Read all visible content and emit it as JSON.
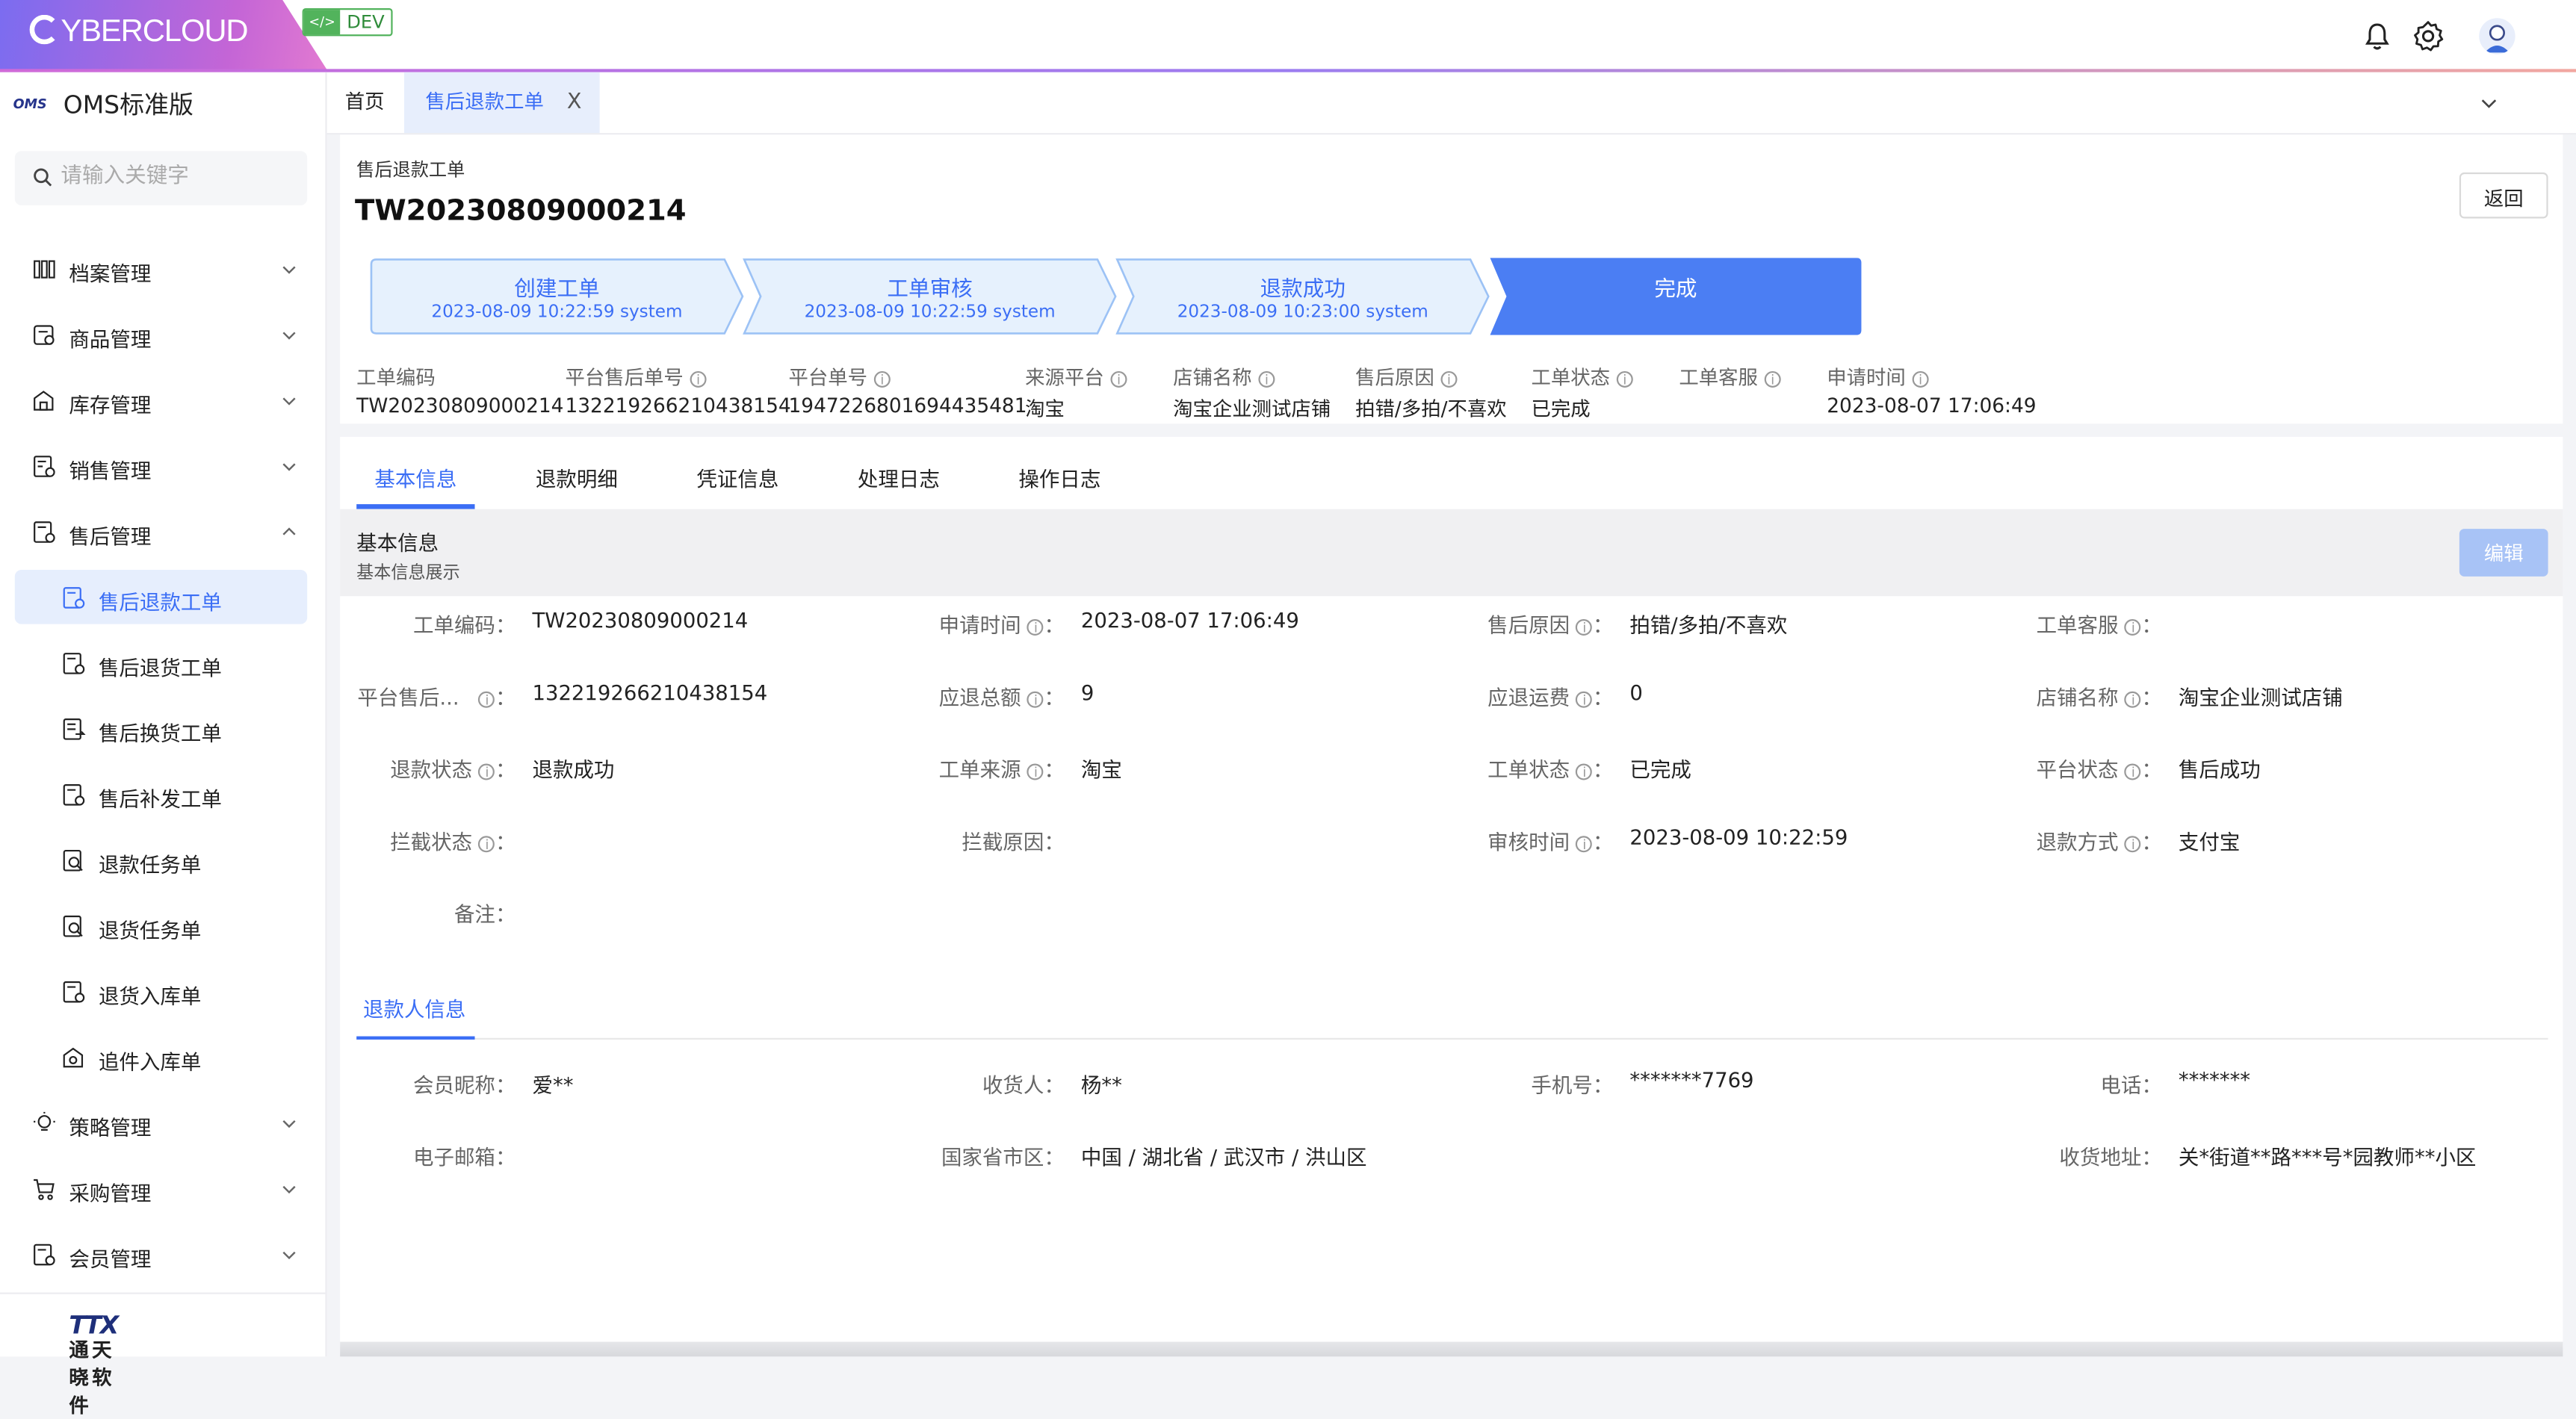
{
  "app": {
    "logo_text": "YBERCLOUD",
    "env_badge": "DEV",
    "env_badge_icon": "code-icon"
  },
  "sidebar": {
    "title": "OMS标准版",
    "brand_mark": "OMS",
    "search_placeholder": "请输入关键字",
    "menu": [
      {
        "label": "档案管理",
        "icon": "archive-icon",
        "expanded": false
      },
      {
        "label": "商品管理",
        "icon": "goods-icon",
        "expanded": false
      },
      {
        "label": "库存管理",
        "icon": "warehouse-icon",
        "expanded": false
      },
      {
        "label": "销售管理",
        "icon": "sales-icon",
        "expanded": false
      },
      {
        "label": "售后管理",
        "icon": "aftersale-icon",
        "expanded": true
      }
    ],
    "submenu": [
      {
        "label": "售后退款工单",
        "active": true
      },
      {
        "label": "售后退货工单"
      },
      {
        "label": "售后换货工单"
      },
      {
        "label": "售后补发工单"
      },
      {
        "label": "退款任务单"
      },
      {
        "label": "退货任务单"
      },
      {
        "label": "退货入库单"
      },
      {
        "label": "追件入库单"
      }
    ],
    "menu2": [
      {
        "label": "策略管理",
        "icon": "strategy-icon"
      },
      {
        "label": "采购管理",
        "icon": "cart-icon"
      },
      {
        "label": "会员管理",
        "icon": "member-icon"
      }
    ],
    "footer_logo": "TTX",
    "footer_company": "通天晓软件"
  },
  "tabbar": {
    "home": "首页",
    "current": "售后退款工单",
    "close": "X"
  },
  "page": {
    "breadcrumb": "售后退款工单",
    "order_no": "TW20230809000214",
    "back_label": "返回",
    "steps": [
      {
        "title": "创建工单",
        "detail": "2023-08-09 10:22:59 system",
        "state": "finished"
      },
      {
        "title": "工单审核",
        "detail": "2023-08-09 10:22:59 system",
        "state": "finished"
      },
      {
        "title": "退款成功",
        "detail": "2023-08-09 10:23:00 system",
        "state": "finished"
      },
      {
        "title": "完成",
        "detail": "",
        "state": "current"
      }
    ],
    "summary": [
      {
        "label": "工单编码",
        "value": "TW20230809000214",
        "help": false
      },
      {
        "label": "平台售后单号",
        "value": "132219266210438154",
        "help": true
      },
      {
        "label": "平台单号",
        "value": "1947226801694435481",
        "help": true
      },
      {
        "label": "来源平台",
        "value": "淘宝",
        "help": true
      },
      {
        "label": "店铺名称",
        "value": "淘宝企业测试店铺",
        "help": true
      },
      {
        "label": "售后原因",
        "value": "拍错/多拍/不喜欢",
        "help": true
      },
      {
        "label": "工单状态",
        "value": "已完成",
        "help": true
      },
      {
        "label": "工单客服",
        "value": "",
        "help": true
      },
      {
        "label": "申请时间",
        "value": "2023-08-07 17:06:49",
        "help": true
      }
    ]
  },
  "detail_tabs": [
    "基本信息",
    "退款明细",
    "凭证信息",
    "处理日志",
    "操作日志"
  ],
  "basic": {
    "title": "基本信息",
    "subtitle": "基本信息展示",
    "edit_label": "编辑",
    "rows": [
      [
        {
          "label": "工单编码",
          "help": false,
          "value": "TW20230809000214"
        },
        {
          "label": "申请时间",
          "help": true,
          "value": "2023-08-07 17:06:49"
        },
        {
          "label": "售后原因",
          "help": true,
          "value": "拍错/多拍/不喜欢"
        },
        {
          "label": "工单客服",
          "help": true,
          "value": ""
        }
      ],
      [
        {
          "label": "平台售后...",
          "help": true,
          "value": "132219266210438154"
        },
        {
          "label": "应退总额",
          "help": true,
          "value": "9"
        },
        {
          "label": "应退运费",
          "help": true,
          "value": "0"
        },
        {
          "label": "店铺名称",
          "help": true,
          "value": "淘宝企业测试店铺"
        }
      ],
      [
        {
          "label": "退款状态",
          "help": true,
          "value": "退款成功"
        },
        {
          "label": "工单来源",
          "help": true,
          "value": "淘宝"
        },
        {
          "label": "工单状态",
          "help": true,
          "value": "已完成"
        },
        {
          "label": "平台状态",
          "help": true,
          "value": "售后成功"
        }
      ],
      [
        {
          "label": "拦截状态",
          "help": true,
          "value": ""
        },
        {
          "label": "拦截原因",
          "help": false,
          "value": ""
        },
        {
          "label": "审核时间",
          "help": true,
          "value": "2023-08-09 10:22:59"
        },
        {
          "label": "退款方式",
          "help": true,
          "value": "支付宝"
        }
      ],
      [
        {
          "label": "备注",
          "help": false,
          "value": ""
        }
      ]
    ]
  },
  "refunder": {
    "tab_label": "退款人信息",
    "rows": [
      [
        {
          "label": "会员昵称",
          "value": "爱**"
        },
        {
          "label": "收货人",
          "value": "杨**"
        },
        {
          "label": "手机号",
          "value": "*******7769"
        },
        {
          "label": "电话",
          "value": "*******"
        }
      ],
      [
        {
          "label": "电子邮箱",
          "value": ""
        },
        {
          "label": "国家省市区",
          "value": "中国 / 湖北省 / 武汉市 / 洪山区"
        },
        {
          "label": "",
          "value": ""
        },
        {
          "label": "收货地址",
          "value": "关*街道**路***号*园教师**小区"
        }
      ]
    ]
  },
  "colors": {
    "accent": "#3b6ef5",
    "step_fill": "#e6f1fd",
    "step_border": "#9cc2f5",
    "step_done": "#4b7ef3"
  }
}
